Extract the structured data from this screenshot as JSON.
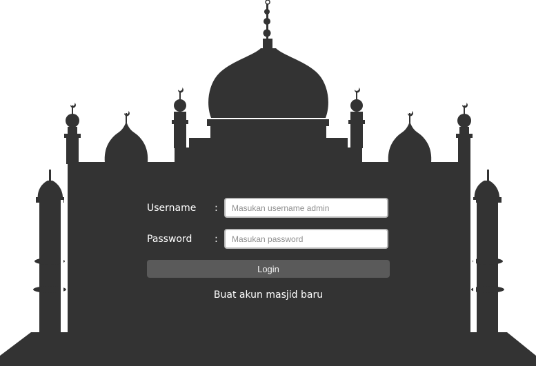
{
  "login_form": {
    "username_label": "Username",
    "username_separator": ":",
    "username_placeholder": "Masukan username admin",
    "username_value": "",
    "password_label": "Password",
    "password_separator": ":",
    "password_placeholder": "Masukan password",
    "password_value": "",
    "login_button": "Login",
    "register_link": "Buat akun masjid baru"
  },
  "colors": {
    "silhouette": "#333333",
    "background": "#ffffff",
    "button": "#5a5a5a"
  }
}
